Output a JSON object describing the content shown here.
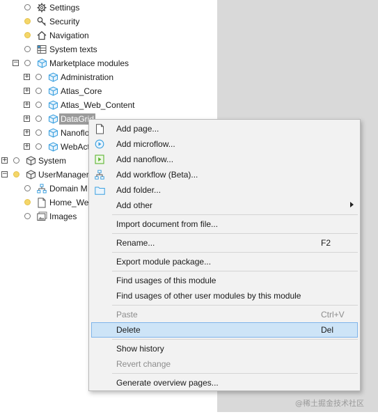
{
  "tree": {
    "settings": "Settings",
    "security": "Security",
    "navigation": "Navigation",
    "system_texts": "System texts",
    "marketplace_modules": "Marketplace modules",
    "administration": "Administration",
    "atlas_core": "Atlas_Core",
    "atlas_web_content": "Atlas_Web_Content",
    "datagrid": "DataGrid",
    "nanoflow_partial": "Nanoflo",
    "webactions_partial": "WebAct",
    "system": "System",
    "user_management_partial": "UserManager",
    "domain_model_partial": "Domain M",
    "home_web_partial": "Home_Wel",
    "images": "Images"
  },
  "context_menu": {
    "add_page": "Add page...",
    "add_microflow": "Add microflow...",
    "add_nanoflow": "Add nanoflow...",
    "add_workflow": "Add workflow (Beta)...",
    "add_folder": "Add folder...",
    "add_other": "Add other",
    "import_document": "Import document from file...",
    "rename": "Rename...",
    "rename_shortcut": "F2",
    "export_module": "Export module package...",
    "find_usages": "Find usages of this module",
    "find_usages_other": "Find usages of other user modules by this module",
    "paste": "Paste",
    "paste_shortcut": "Ctrl+V",
    "delete": "Delete",
    "delete_shortcut": "Del",
    "show_history": "Show history",
    "revert_change": "Revert change",
    "generate_overview": "Generate overview pages..."
  },
  "watermark": "@稀土掘金技术社区",
  "colors": {
    "highlight_bg": "#cde4f7",
    "highlight_border": "#7eb4ea",
    "status_dot_yellow": "#f4d669",
    "module_icon_blue": "#3aa0e0",
    "side_panel_gray": "#d9d9d9"
  },
  "icons": {
    "settings": "gear-icon",
    "security": "key-icon",
    "navigation": "home-icon",
    "system_texts": "text-table-icon",
    "module": "cube-icon",
    "domain_model": "hierarchy-icon",
    "page": "document-icon",
    "images": "images-icon",
    "microflow": "microflow-icon",
    "nanoflow": "nanoflow-icon",
    "workflow": "workflow-icon",
    "folder": "folder-icon"
  }
}
